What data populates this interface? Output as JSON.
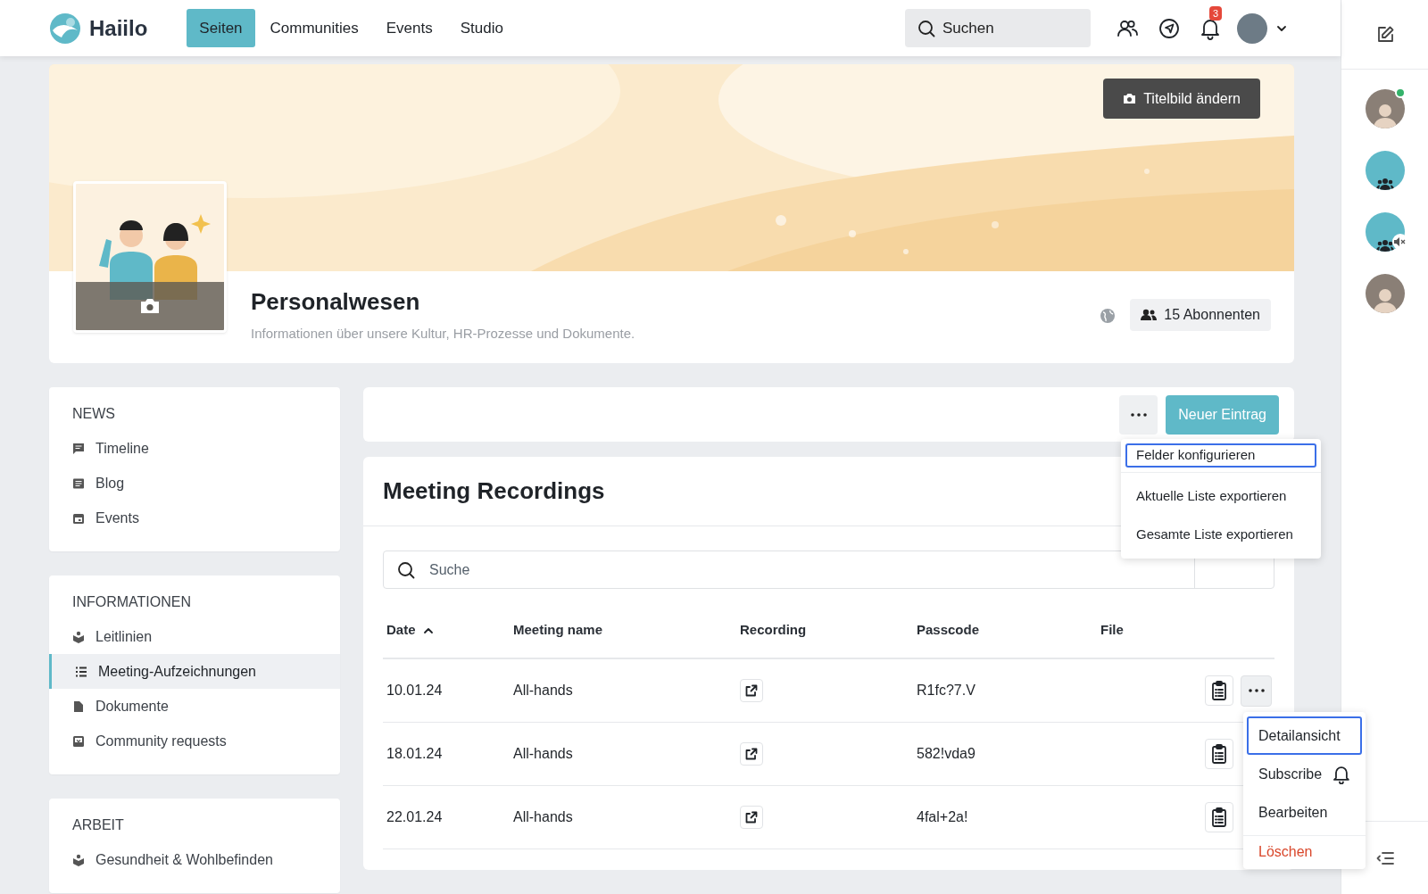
{
  "nav": {
    "logo": "Haiilo",
    "tabs": [
      {
        "label": "Seiten",
        "selected": true
      },
      {
        "label": "Communities",
        "selected": false
      },
      {
        "label": "Events",
        "selected": false
      },
      {
        "label": "Studio",
        "selected": false
      }
    ],
    "search": {
      "placeholder": "Suchen"
    },
    "notifications": {
      "badge": "3"
    }
  },
  "cover": {
    "button": "Titelbild ändern"
  },
  "page": {
    "title": "Personalwesen",
    "description": "Informationen über unsere Kultur, HR-Prozesse und Dokumente.",
    "subscribers": "15 Abonnenten"
  },
  "sidebar": {
    "sections": [
      {
        "heading": "NEWS",
        "items": [
          {
            "label": "Timeline",
            "kind": "timeline",
            "selected": false
          },
          {
            "label": "Blog",
            "kind": "blog",
            "selected": false
          },
          {
            "label": "Events",
            "kind": "calendar",
            "selected": false
          }
        ]
      },
      {
        "heading": "INFORMATIONEN",
        "items": [
          {
            "label": "Leitlinien",
            "kind": "app",
            "selected": false
          },
          {
            "label": "Meeting-Aufzeichnungen",
            "kind": "list",
            "selected": true
          },
          {
            "label": "Dokumente",
            "kind": "document",
            "selected": false
          },
          {
            "label": "Community requests",
            "kind": "request",
            "selected": false
          }
        ]
      },
      {
        "heading": "ARBEIT",
        "items": [
          {
            "label": "Gesundheit & Wohlbefinden",
            "kind": "app",
            "selected": false
          }
        ]
      }
    ]
  },
  "toolbar": {
    "new_button": "Neuer Eintrag"
  },
  "options_menu": {
    "items": [
      {
        "label": "Felder konfigurieren",
        "focused": true
      },
      {
        "label": "Aktuelle Liste exportieren",
        "focused": false
      },
      {
        "label": "Gesamte Liste exportieren",
        "focused": false
      }
    ]
  },
  "list": {
    "title": "Meeting Recordings",
    "search": {
      "placeholder": "Suche"
    },
    "columns": [
      {
        "label": "Date",
        "sorted": true
      },
      {
        "label": "Meeting name",
        "sorted": false
      },
      {
        "label": "Recording",
        "sorted": false
      },
      {
        "label": "Passcode",
        "sorted": false
      },
      {
        "label": "File",
        "sorted": false
      }
    ],
    "rows": [
      {
        "date": "10.01.24",
        "name": "All-hands",
        "passcode": "R1fc?7.V",
        "menu_open": true
      },
      {
        "date": "18.01.24",
        "name": "All-hands",
        "passcode": "582!vda9",
        "menu_open": false
      },
      {
        "date": "22.01.24",
        "name": "All-hands",
        "passcode": "4fal+2a!",
        "menu_open": false
      }
    ]
  },
  "row_menu": {
    "items": [
      {
        "label": "Detailansicht",
        "kind": "plain",
        "focused": true
      },
      {
        "label": "Subscribe",
        "kind": "bell",
        "focused": false
      },
      {
        "label": "Bearbeiten",
        "kind": "plain",
        "focused": false
      },
      {
        "label": "Löschen",
        "kind": "danger",
        "focused": false
      }
    ]
  },
  "right_rail": {
    "items": [
      {
        "kind": "person",
        "online": true
      },
      {
        "kind": "group",
        "online": false
      },
      {
        "kind": "group_muted",
        "online": false
      },
      {
        "kind": "person",
        "online": false
      }
    ]
  }
}
